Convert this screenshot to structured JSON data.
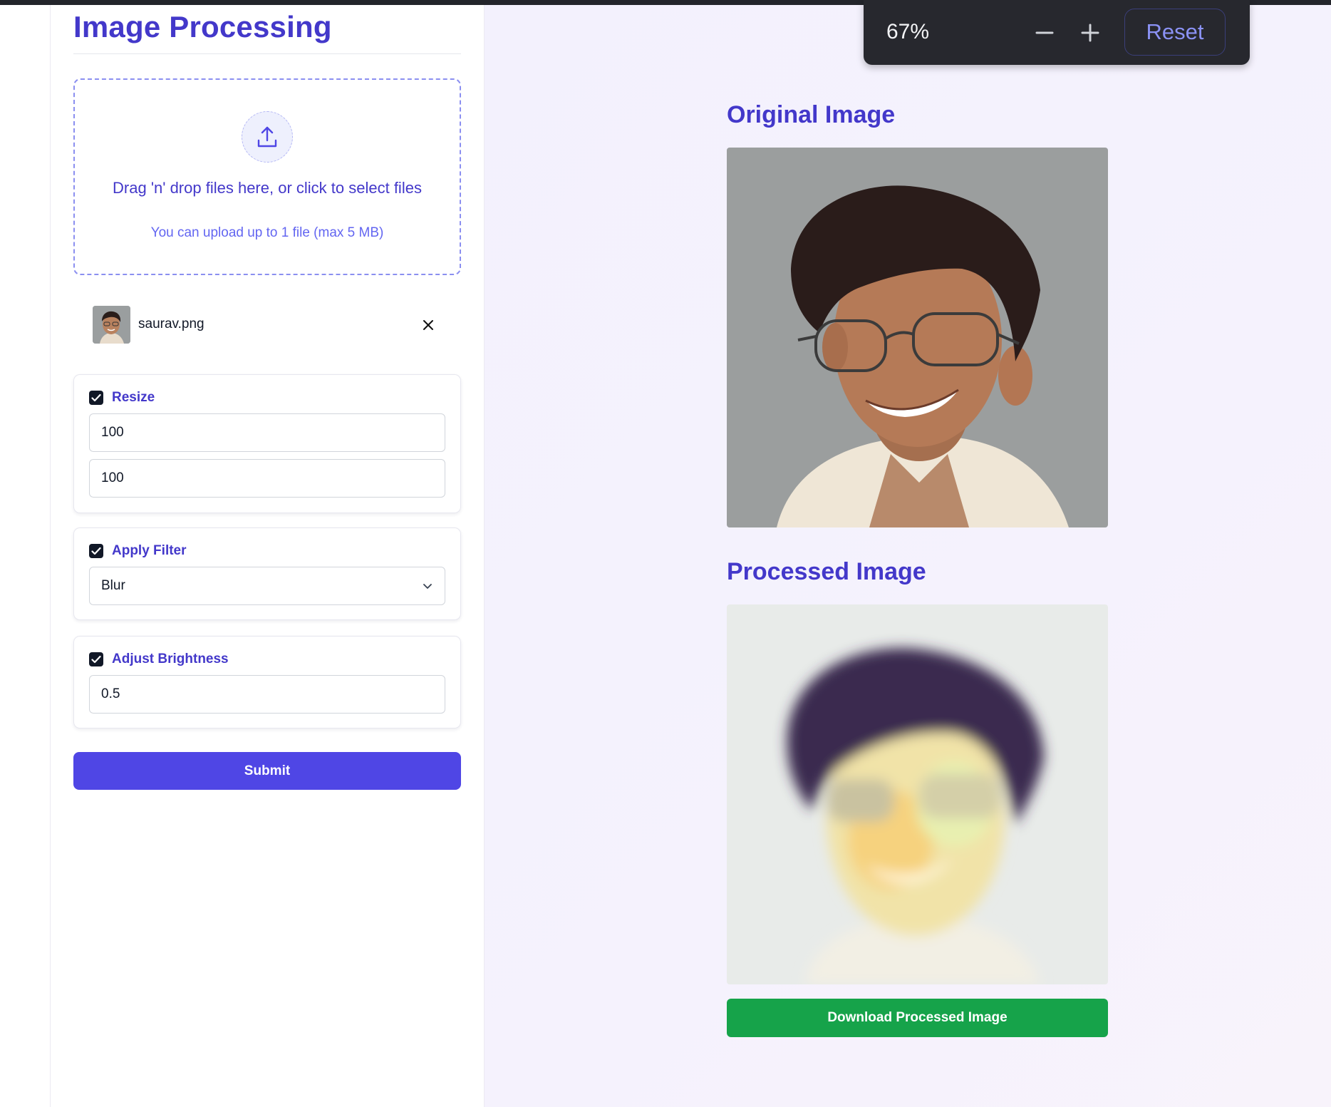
{
  "page": {
    "title": "Image Processing"
  },
  "dropzone": {
    "title": "Drag 'n' drop files here, or click to select files",
    "subtitle": "You can upload up to 1 file (max 5 MB)",
    "icon": "upload-icon"
  },
  "file": {
    "name": "saurav.png",
    "remove_icon": "close-icon"
  },
  "resize": {
    "label": "Resize",
    "checked": true,
    "width": "100",
    "height": "100"
  },
  "filter": {
    "label": "Apply Filter",
    "checked": true,
    "selected": "Blur"
  },
  "brightness": {
    "label": "Adjust Brightness",
    "checked": true,
    "value": "0.5"
  },
  "submit_label": "Submit",
  "original": {
    "heading": "Original Image"
  },
  "processed": {
    "heading": "Processed Image"
  },
  "download_label": "Download Processed Image",
  "zoom": {
    "level": "67%",
    "decrease_icon": "minus-icon",
    "increase_icon": "plus-icon",
    "reset_label": "Reset"
  },
  "colors": {
    "accent": "#4338ca",
    "primary_button": "#4f46e5",
    "success_button": "#16a34a",
    "page_background": "#f4f2fd",
    "zoom_bar": "#27282e"
  }
}
